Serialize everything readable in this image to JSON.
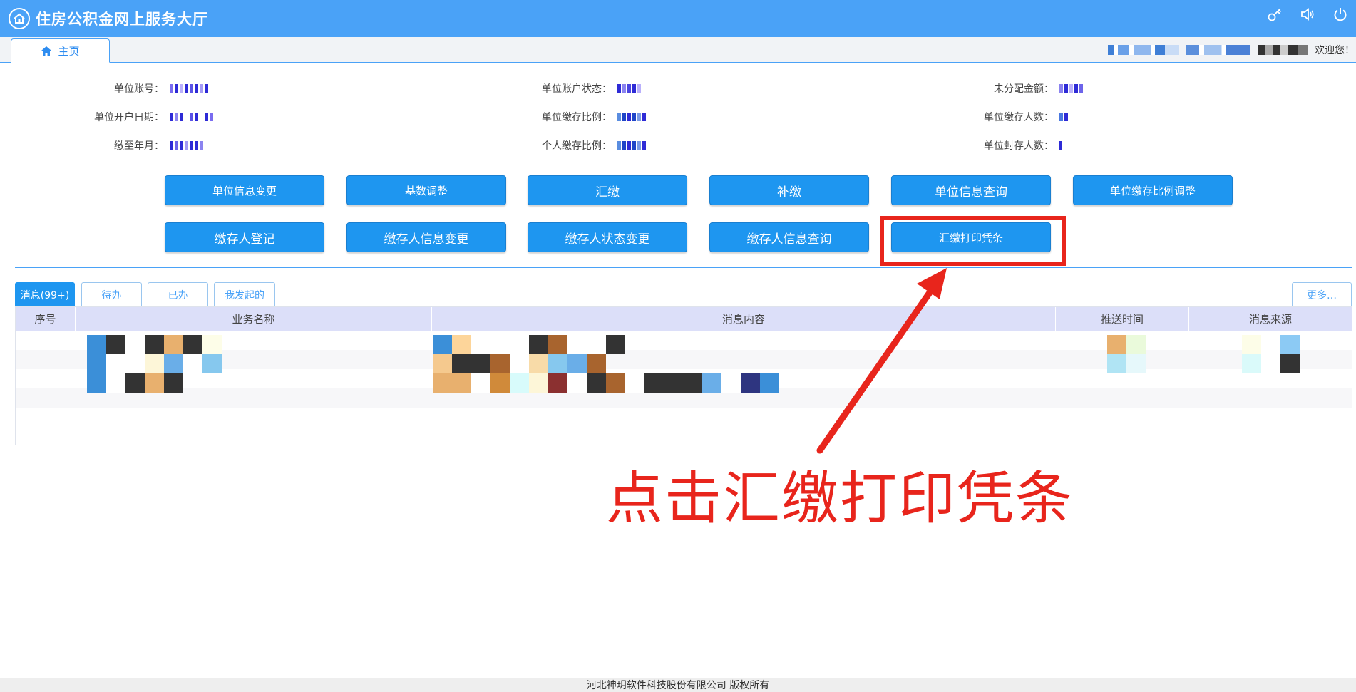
{
  "header": {
    "title": "住房公积金网上服务大厅",
    "icons": [
      "key-icon",
      "speaker-icon",
      "power-icon"
    ],
    "bg_color": "#4aa2f7"
  },
  "tabs": {
    "home_label": "主页"
  },
  "user": {
    "welcome": "欢迎您！"
  },
  "info": {
    "account_label": "单位账号：",
    "open_date_label": "单位开户日期：",
    "paid_until_label": "缴至年月：",
    "account_status_label": "单位账户状态：",
    "unit_ratio_label": "单位缴存比例：",
    "personal_ratio_label": "个人缴存比例：",
    "unallocated_label": "未分配金额：",
    "depositors_label": "单位缴存人数：",
    "sealed_label": "单位封存人数："
  },
  "actions": {
    "row1": [
      "单位信息变更",
      "基数调整",
      "汇缴",
      "补缴",
      "单位信息查询",
      "单位缴存比例调整"
    ],
    "row2": [
      "缴存人登记",
      "缴存人信息变更",
      "缴存人状态变更",
      "缴存人信息查询",
      "汇缴打印凭条"
    ]
  },
  "messages": {
    "tabs": [
      "消息(99+)",
      "待办",
      "已办",
      "我发起的"
    ],
    "more": "更多…",
    "columns": [
      "序号",
      "业务名称",
      "消息内容",
      "推送时间",
      "消息来源"
    ]
  },
  "annotation": {
    "text": "点击汇缴打印凭条",
    "color": "#e8251c"
  },
  "footer": {
    "copyright": "河北神玥软件科技股份有限公司 版权所有"
  }
}
